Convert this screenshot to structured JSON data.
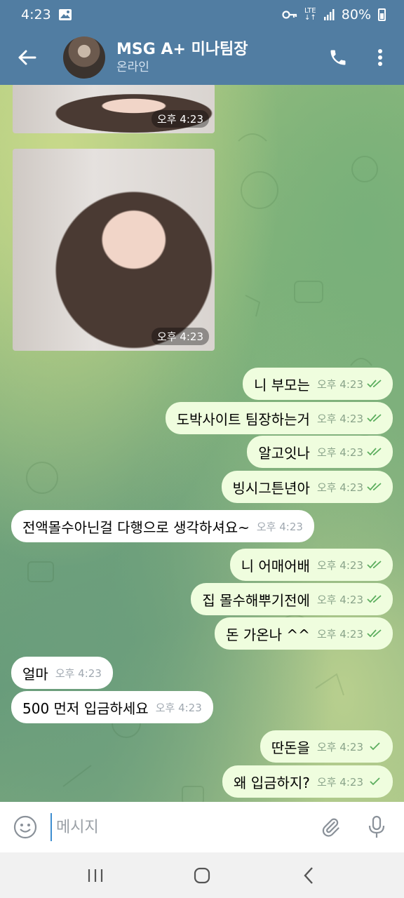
{
  "status_bar": {
    "time": "4:23",
    "battery": "80%"
  },
  "header": {
    "title": "MSG A+ 미나팀장",
    "status": "온라인"
  },
  "photos": [
    {
      "time": "오후 4:23"
    },
    {
      "time": "오후 4:23"
    }
  ],
  "messages": [
    {
      "dir": "out",
      "text": "니 부모는",
      "time": "오후 4:23",
      "read": true
    },
    {
      "dir": "out",
      "text": "도박사이트 팀장하는거",
      "time": "오후 4:23",
      "read": true
    },
    {
      "dir": "out",
      "text": "알고잇나",
      "time": "오후 4:23",
      "read": true
    },
    {
      "dir": "out",
      "text": "빙시그튼년아",
      "time": "오후 4:23",
      "read": true
    },
    {
      "dir": "in",
      "text": "전액몰수아닌걸 다행으로 생각하셔요~",
      "time": "오후 4:23"
    },
    {
      "dir": "out",
      "text": "니 어매어배",
      "time": "오후 4:23",
      "read": true
    },
    {
      "dir": "out",
      "text": "집 몰수해뿌기전에",
      "time": "오후 4:23",
      "read": true
    },
    {
      "dir": "out",
      "text": "돈 가온나 ^^",
      "time": "오후 4:23",
      "read": true
    },
    {
      "dir": "in",
      "text": "얼마",
      "time": "오후 4:23"
    },
    {
      "dir": "in",
      "text": "500 먼저 입금하세요",
      "time": "오후 4:23"
    },
    {
      "dir": "out",
      "text": "딴돈을",
      "time": "오후 4:23",
      "read": false
    },
    {
      "dir": "out",
      "text": "왜 입금하지?",
      "time": "오후 4:23",
      "read": false
    }
  ],
  "input": {
    "placeholder": "메시지"
  },
  "colors": {
    "header": "#517da2",
    "out_bubble": "#effdde",
    "in_bubble": "#ffffff",
    "check": "#5cae5e"
  }
}
